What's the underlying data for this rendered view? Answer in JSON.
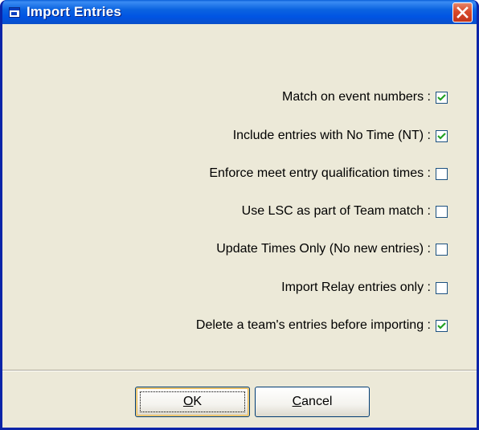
{
  "window": {
    "title": "Import Entries",
    "close_icon": "close-icon",
    "app_icon": "window-icon"
  },
  "options": [
    {
      "label": "Match on event numbers :",
      "checked": true
    },
    {
      "label": "Include entries with No Time (NT) :",
      "checked": true
    },
    {
      "label": "Enforce meet entry qualification times :",
      "checked": false
    },
    {
      "label": "Use LSC as part of Team match :",
      "checked": false
    },
    {
      "label": "Update Times Only (No new entries) :",
      "checked": false
    },
    {
      "label": "Import Relay entries only :",
      "checked": false
    },
    {
      "label": "Delete a team's entries before importing :",
      "checked": true
    }
  ],
  "buttons": {
    "ok": {
      "accel": "O",
      "rest": "K"
    },
    "cancel": {
      "accel": "C",
      "rest": "ancel"
    }
  },
  "colors": {
    "titlebar": "#0054e3",
    "dialog_bg": "#ece9d8",
    "close_button": "#d8492a"
  }
}
